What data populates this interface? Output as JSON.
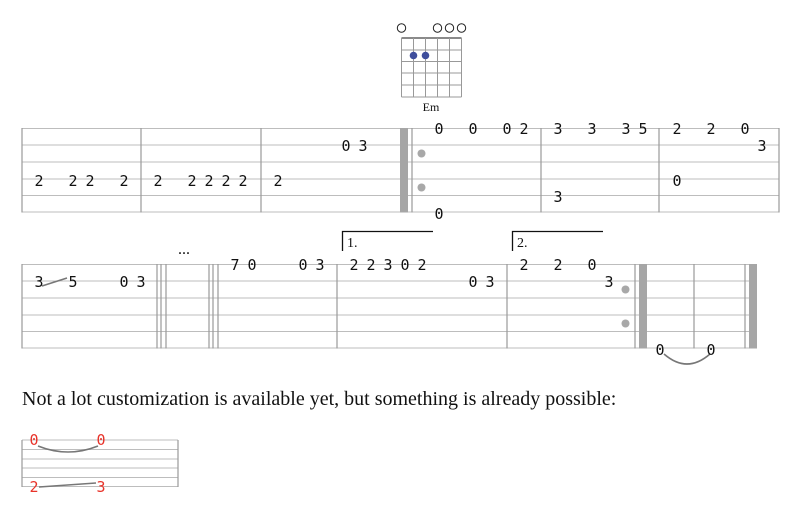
{
  "chord": {
    "name": "Em",
    "open_strings_marks": [
      "o",
      "o",
      "o",
      "o"
    ],
    "fretted": [
      {
        "string": 2,
        "fret": 2
      },
      {
        "string": 3,
        "fret": 2
      }
    ],
    "dot_color": "#3f4e9c"
  },
  "system1": {
    "measures": [
      {
        "id": "m1",
        "notes": [
          "2",
          "2",
          "2",
          "2"
        ]
      },
      {
        "id": "m2",
        "notes": [
          "2",
          "2",
          "2",
          "2",
          "2"
        ]
      },
      {
        "id": "m3",
        "notes": [
          "2",
          "0",
          "3"
        ]
      },
      {
        "id": "m4",
        "notes": [
          "0",
          "0",
          "0",
          "2",
          "0"
        ]
      },
      {
        "id": "m5",
        "notes": [
          "3",
          "3",
          "3",
          "5",
          "3"
        ]
      },
      {
        "id": "m6",
        "notes": [
          "2",
          "2",
          "0",
          "3",
          "0"
        ]
      }
    ]
  },
  "system2": {
    "ellipsis": "...",
    "volta1": "1.",
    "volta2": "2.",
    "measures": [
      {
        "id": "m7",
        "notes": [
          "3",
          "5",
          "0",
          "3"
        ]
      },
      {
        "id": "m8",
        "notes": [
          "7",
          "0",
          "0",
          "3"
        ]
      },
      {
        "id": "m9",
        "notes": [
          "2",
          "2",
          "3",
          "0",
          "2",
          "0",
          "3"
        ]
      },
      {
        "id": "m10",
        "notes": [
          "2",
          "2",
          "0",
          "3"
        ]
      },
      {
        "id": "m11",
        "notes": [
          "0",
          "0"
        ]
      }
    ]
  },
  "caption": "Not a lot customization is available yet, but something is already possible:",
  "example": {
    "notes": [
      "0",
      "0",
      "2",
      "3"
    ],
    "note_color": "#e8332a"
  },
  "colors": {
    "staff_line": "#bdbdbd",
    "barline": "#9a9a9a",
    "thick_barline": "#a6a6a6",
    "repeat_dot": "#a8a8a8",
    "tie": "#777777"
  }
}
